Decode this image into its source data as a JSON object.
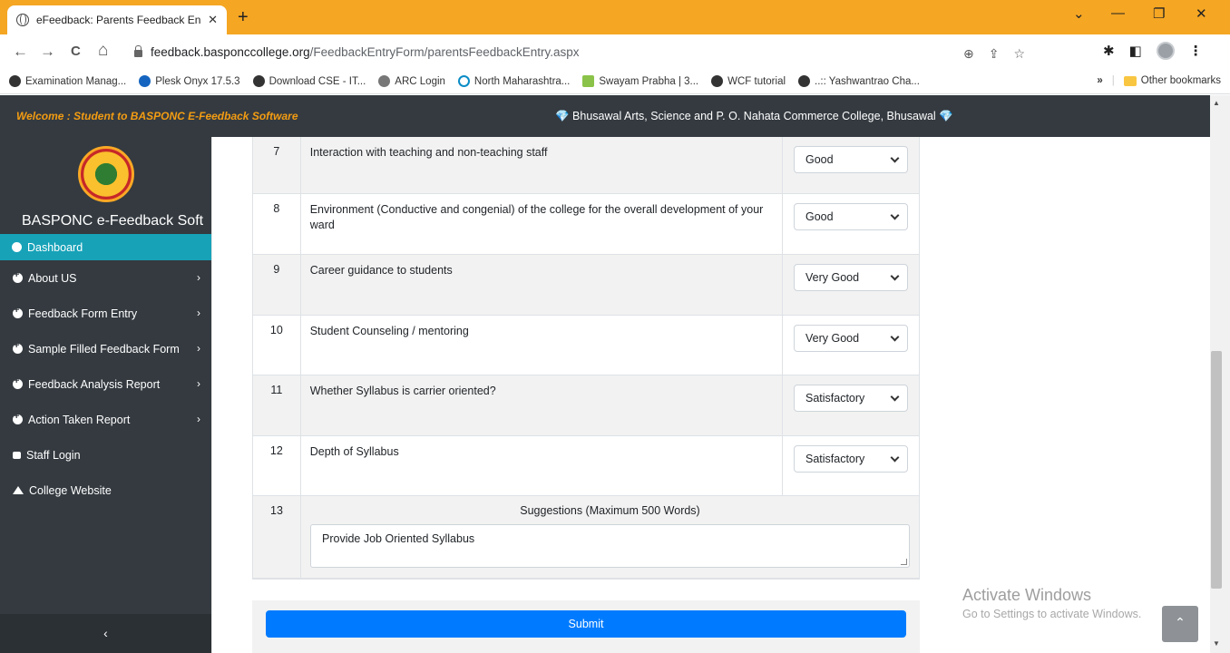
{
  "browser": {
    "tab_title": "eFeedback: Parents Feedback Ent",
    "tab_close": "✕",
    "new_tab": "+",
    "window_controls": [
      "⌄",
      "—",
      "❐",
      "✕"
    ],
    "nav": {
      "back": "←",
      "forward": "→",
      "reload": "C",
      "home": "⌂"
    },
    "url_domain": "feedback.basponccollege.org",
    "url_path": "/FeedbackEntryForm/parentsFeedbackEntry.aspx",
    "omni_icons": [
      "⊕",
      "⇪",
      "☆"
    ],
    "extension_icons": [
      "✱",
      "◧"
    ],
    "menu_icon": "⋮",
    "bookmarks": [
      {
        "label": "Examination Manag...",
        "icon": "globe-icon"
      },
      {
        "label": "Plesk Onyx 17.5.3",
        "icon": "plesk-icon"
      },
      {
        "label": "Download CSE - IT...",
        "icon": "globe-icon"
      },
      {
        "label": "ARC Login",
        "icon": "arc-icon"
      },
      {
        "label": "North Maharashtra...",
        "icon": "nmu-icon"
      },
      {
        "label": "Swayam Prabha | 3...",
        "icon": "swayam-icon"
      },
      {
        "label": "WCF tutorial",
        "icon": "globe-icon"
      },
      {
        "label": "..:: Yashwantrao Cha...",
        "icon": "globe-icon"
      }
    ],
    "more_bookmarks": "»",
    "other_bookmarks": "Other bookmarks"
  },
  "header": {
    "welcome": "Welcome : Student to BASPONC E-Feedback Software",
    "college": "💎 Bhusawal Arts, Science and P. O. Nahata Commerce College, Bhusawal 💎"
  },
  "sidebar": {
    "brand": "BASPONC e-Feedback Soft",
    "items": [
      {
        "label": "Dashboard",
        "active": true,
        "has_children": false
      },
      {
        "label": "About US",
        "has_children": true
      },
      {
        "label": "Feedback Form Entry",
        "has_children": true
      },
      {
        "label": "Sample Filled Feedback Form",
        "has_children": true
      },
      {
        "label": "Feedback Analysis Report",
        "has_children": true
      },
      {
        "label": "Action Taken Report",
        "has_children": true
      },
      {
        "label": "Staff Login",
        "has_children": false
      },
      {
        "label": "College Website",
        "has_children": false
      }
    ],
    "chevron": "›",
    "collapse": "‹"
  },
  "questions": [
    {
      "num": "7",
      "text": "Interaction with teaching and non-teaching staff",
      "answer": "Good"
    },
    {
      "num": "8",
      "text": "Environment (Conductive and congenial) of the college for the overall development of your ward",
      "answer": "Good"
    },
    {
      "num": "9",
      "text": "Career guidance to students",
      "answer": "Very Good"
    },
    {
      "num": "10",
      "text": "Student Counseling / mentoring",
      "answer": "Very Good"
    },
    {
      "num": "11",
      "text": "Whether Syllabus is carrier oriented?",
      "answer": "Satisfactory"
    },
    {
      "num": "12",
      "text": "Depth of Syllabus",
      "answer": "Satisfactory"
    }
  ],
  "suggestions": {
    "num": "13",
    "title": "Suggestions (Maximum 500 Words)",
    "value": "Provide Job Oriented Syllabus"
  },
  "submit_label": "Submit",
  "watermark": {
    "line1": "Activate Windows",
    "line2": "Go to Settings to activate Windows."
  },
  "back_to_top": "⌃",
  "scroll_up": "▲",
  "scroll_down": "▼"
}
